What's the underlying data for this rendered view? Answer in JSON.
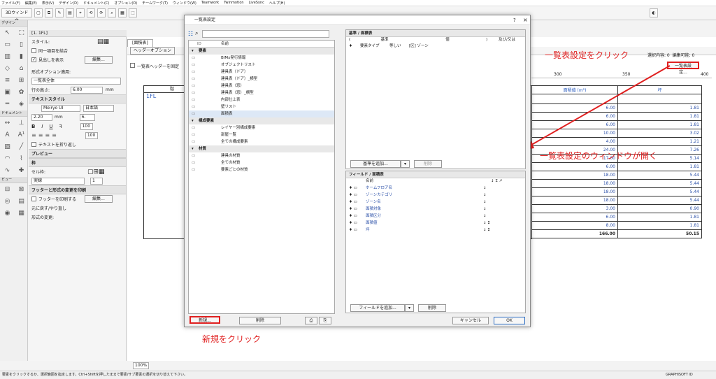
{
  "menubar": [
    "ファイル(F)",
    "編集(E)",
    "表示(V)",
    "デザイン(D)",
    "ドキュメント(C)",
    "オプション(O)",
    "チームワーク(T)",
    "ウィンドウ(W)",
    "Teamwork",
    "Twinmotion",
    "LiveSync",
    "ヘルプ(H)"
  ],
  "toolbar": {
    "view_label": "3Dウィンドウ"
  },
  "toolbox": {
    "design_label": "デザイン",
    "document_label": "ドキュメント",
    "view_label": "ビュー"
  },
  "info": {
    "tab": "[1. 1FL]",
    "style_label": "スタイル:",
    "merge_label": "同一項目を結合",
    "headers_label": "見出しを表示",
    "edit_button": "編集...",
    "format_label": "形式オプション適用:",
    "format_value": "一覧表全体",
    "row_height_label": "行の高さ:",
    "row_height_value": "6.00",
    "unit_mm": "mm",
    "text_style": "テキストスタイル",
    "font": "Meiryo UI",
    "language": "日本語",
    "size": "2.20",
    "pct": "100",
    "wrap": "テキストを折り返し",
    "preview": "プレビュー",
    "frame": "枠",
    "cell_label": "セル枠:",
    "line_type": "実線",
    "pen": "1",
    "footer": "フッターと形式の変更を印刷",
    "footer_print": "フッターを印刷する",
    "undo_label": "元に戻す/やり直し",
    "format_change": "形式の変更:"
  },
  "doc": {
    "tab": "[面積表]",
    "header_opt": "ヘッダーオプション",
    "fix_header": "一覧表ヘッダーを固定",
    "ruler": [
      "300",
      "350",
      "400"
    ],
    "selection": "選択内容: 0",
    "edit_count": "編集可能: 0",
    "settings_button": "一覧表設定...",
    "zoom": "100%",
    "col_room": "階",
    "col_area": "面積値 (m²)",
    "col_tsubo": "坪",
    "first_row": "1FL",
    "areas": [
      "6.00",
      "6.00",
      "6.00",
      "10.00",
      "4.00",
      "24.00",
      "17.00",
      "6.00",
      "18.00",
      "18.00",
      "18.00",
      "18.00",
      "3.00",
      "6.00",
      "8.00"
    ],
    "tsubo": [
      "1.81",
      "1.81",
      "1.81",
      "3.02",
      "1.21",
      "7.26",
      "5.14",
      "1.81",
      "5.44",
      "5.44",
      "5.44",
      "5.44",
      "0.90",
      "1.81",
      "1.81"
    ],
    "total_area": "166.00",
    "total_tsubo": "50.15"
  },
  "dialog": {
    "title": "一覧表設定",
    "help": "?",
    "close": "×",
    "col_id": "ID",
    "col_name": "名前",
    "groups": [
      {
        "name": "要素",
        "items": [
          "BIMx発行情報",
          "オブジェクトリスト",
          "建具表（ドア）",
          "建具表（ドア）_横型",
          "建具表（窓）",
          "建具表（窓）_横型",
          "内部仕上表",
          "壁リスト",
          "面積表"
        ]
      },
      {
        "name": "構成要素",
        "items": [
          "レイヤー別構成要素",
          "部屋一覧",
          "全ての構成要素"
        ]
      },
      {
        "name": "材質",
        "items": [
          "建具の材質",
          "全ての材質",
          "要素ごとの材質"
        ]
      }
    ],
    "criteria_head": "基準 / 面積表",
    "crit_col1": "(",
    "crit_col2": "基準",
    "crit_col3": "値",
    "crit_col4": ")",
    "crit_col5": "及び/又は",
    "crit_row": [
      "要素タイプ",
      "等しい",
      "[区] ゾーン"
    ],
    "add_criteria": "基準を追加...",
    "delete_criteria": "削除",
    "fields_head": "フィールド / 面積表",
    "field_col": "名前",
    "fields": [
      "ホームフロア名",
      "ゾーンカテゴリ",
      "ゾーン名",
      "面積対象",
      "面積区分",
      "面積値",
      "坪"
    ],
    "add_field": "フィールドを追加...",
    "delete_field": "削除",
    "new_button": "新規...",
    "delete_button": "削除",
    "cancel": "キャンセル",
    "ok": "OK"
  },
  "annotations": {
    "click_settings": "一覧表設定をクリック",
    "window_opens": "一覧表設定のウィンドウが開く",
    "click_new": "新規をクリック"
  },
  "status": {
    "hint": "要素をクリックするか、選択範囲を指定します。Ctrl+Shiftを押したままで要素/サブ要素の選択を切り替えて下さい。",
    "brand": "GRAPHISOFT ID"
  }
}
